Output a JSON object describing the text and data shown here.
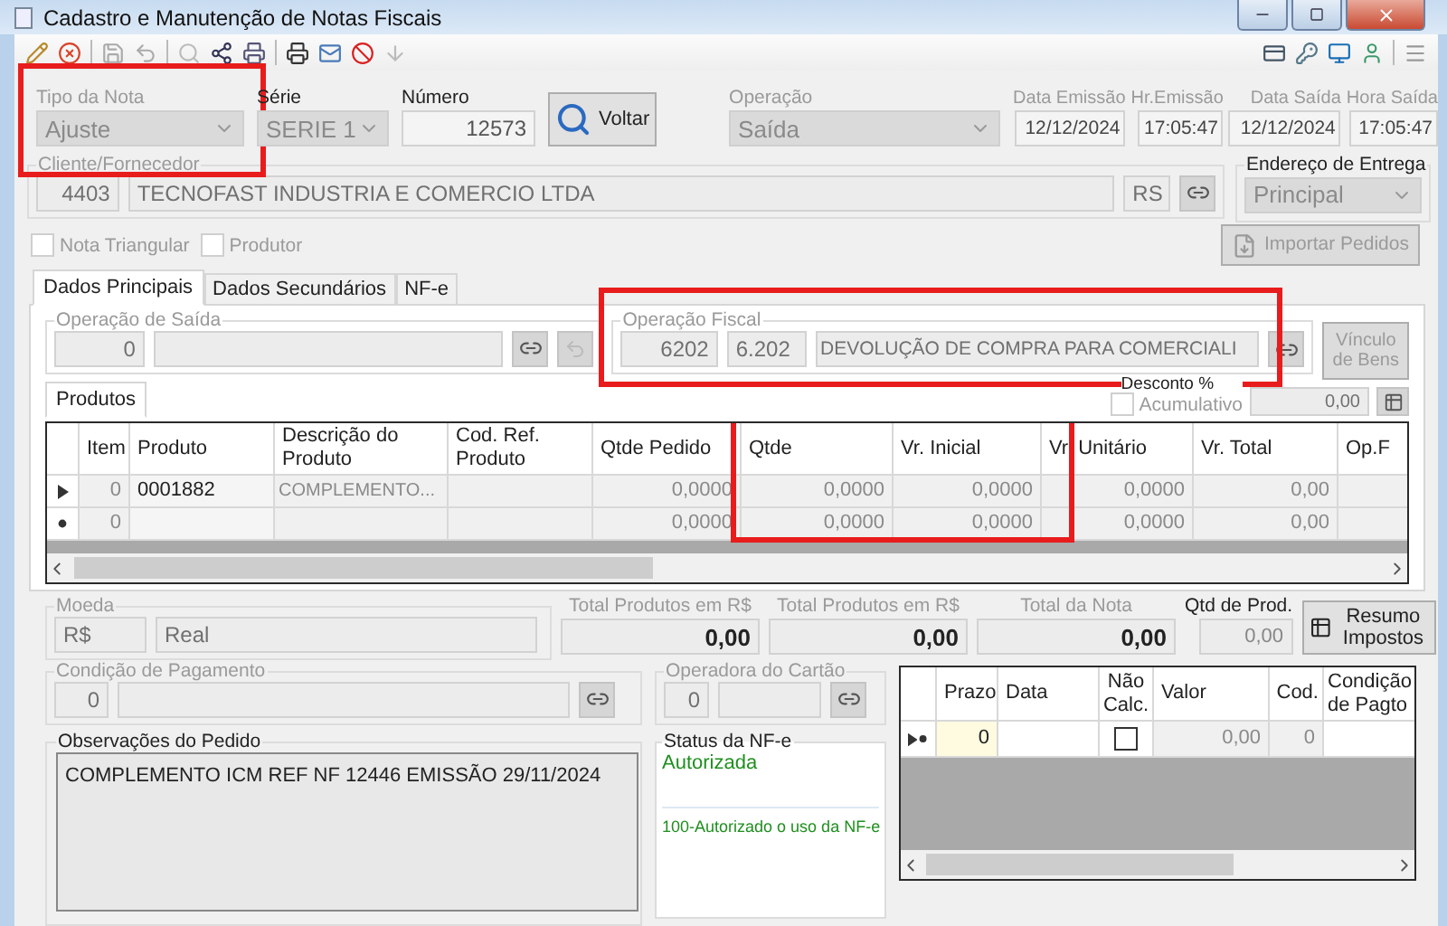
{
  "window": {
    "title": "Cadastro e Manutenção de Notas Fiscais"
  },
  "header": {
    "tipo_da_nota": {
      "label": "Tipo da Nota",
      "value": "Ajuste",
      "highlighted": true
    },
    "serie": {
      "label": "Série",
      "value": "SERIE 1"
    },
    "numero": {
      "label": "Número",
      "value": "12573"
    },
    "voltar_button": "Voltar",
    "operacao": {
      "label": "Operação",
      "value": "Saída"
    },
    "dates": [
      {
        "label": "Data Emissão",
        "value": "12/12/2024"
      },
      {
        "label": "Hr.Emissão",
        "value": "17:05:47"
      },
      {
        "label": "Data Saída",
        "value": "12/12/2024"
      },
      {
        "label": "Hora Saída",
        "value": "17:05:47"
      }
    ]
  },
  "cliente": {
    "label": "Cliente/Fornecedor",
    "code": "4403",
    "name": "TECNOFAST INDUSTRIA E COMERCIO LTDA",
    "uf": "RS"
  },
  "endereco_entrega": {
    "label": "Endereço de Entrega",
    "value": "Principal"
  },
  "options": [
    {
      "label": "Nota Triangular",
      "checked": false
    },
    {
      "label": "Produtor",
      "checked": false
    }
  ],
  "importar_pedidos_button": "Importar Pedidos",
  "tabs": [
    {
      "label": "Dados Principais",
      "selected": true
    },
    {
      "label": "Dados Secundários",
      "selected": false
    },
    {
      "label": "NF-e",
      "selected": false
    }
  ],
  "operacao_saida": {
    "label": "Operação de Saída",
    "code": "0"
  },
  "operacao_fiscal": {
    "label": "Operação Fiscal",
    "code": "6202",
    "cfop": "6.202",
    "description": "DEVOLUÇÃO DE COMPRA PARA COMERCIALI",
    "highlighted": true
  },
  "vinculo_bens_button": "Vínculo de Bens",
  "produtos_tab": "Produtos",
  "desconto": {
    "label": "Desconto %",
    "acumulativo": {
      "label": "Acumulativo",
      "checked": false
    },
    "value": "0,00"
  },
  "produtos_table": {
    "columns": [
      {
        "label": "Item",
        "highlighted": false
      },
      {
        "label": "Produto",
        "highlighted": false
      },
      {
        "label": "Descrição do Produto",
        "highlighted": false
      },
      {
        "label": "Cod. Ref. Produto",
        "highlighted": false
      },
      {
        "label": "Qtde Pedido",
        "highlighted": false
      },
      {
        "label": "Qtde",
        "highlighted": true
      },
      {
        "label": "Vr. Inicial",
        "highlighted": true
      },
      {
        "label": "Vr. Unitário",
        "highlighted": false
      },
      {
        "label": "Vr. Total",
        "highlighted": false
      },
      {
        "label": "Op.F",
        "highlighted": false
      }
    ],
    "rows": [
      {
        "kind": "current",
        "cells": [
          "0",
          "0001882",
          "COMPLEMENTO...",
          null,
          "0,0000",
          "0,0000",
          "0,0000",
          "0,0000",
          "0,00",
          null
        ]
      },
      {
        "kind": "new",
        "cells": [
          "0",
          null,
          null,
          null,
          "0,0000",
          "0,0000",
          "0,0000",
          "0,0000",
          "0,00",
          null
        ]
      }
    ]
  },
  "totais": {
    "moeda": {
      "label": "Moeda",
      "code": "R$",
      "name": "Real"
    },
    "fields": [
      {
        "label": "Total Produtos em R$",
        "value": "0,00"
      },
      {
        "label": "Total Produtos em R$",
        "value": "0,00"
      },
      {
        "label": "Total da Nota",
        "value": "0,00"
      },
      {
        "label": "Qtd de Prod.",
        "value": "0,00"
      }
    ],
    "resumo_button": "Resumo Impostos"
  },
  "condicao_pagamento": {
    "label": "Condição de Pagamento",
    "code": "0"
  },
  "operadora_cartao": {
    "label": "Operadora do Cartão",
    "code": "0"
  },
  "observacoes": {
    "label": "Observações do Pedido",
    "text": "COMPLEMENTO ICM REF NF 12446 EMISSÃO 29/11/2024"
  },
  "status_nfe": {
    "label": "Status da NF-e",
    "status": "Autorizada",
    "message": "100-Autorizado o uso da NF-e"
  },
  "parcelas_table": {
    "columns": [
      "Prazo",
      "Data",
      "Não Calc.",
      "Valor",
      "Cod.",
      "Condição de Pagto"
    ],
    "rows": [
      {
        "kind": "new",
        "prazo": "0",
        "nao_calc": false,
        "valor": "0,00",
        "cod": "0"
      }
    ]
  }
}
